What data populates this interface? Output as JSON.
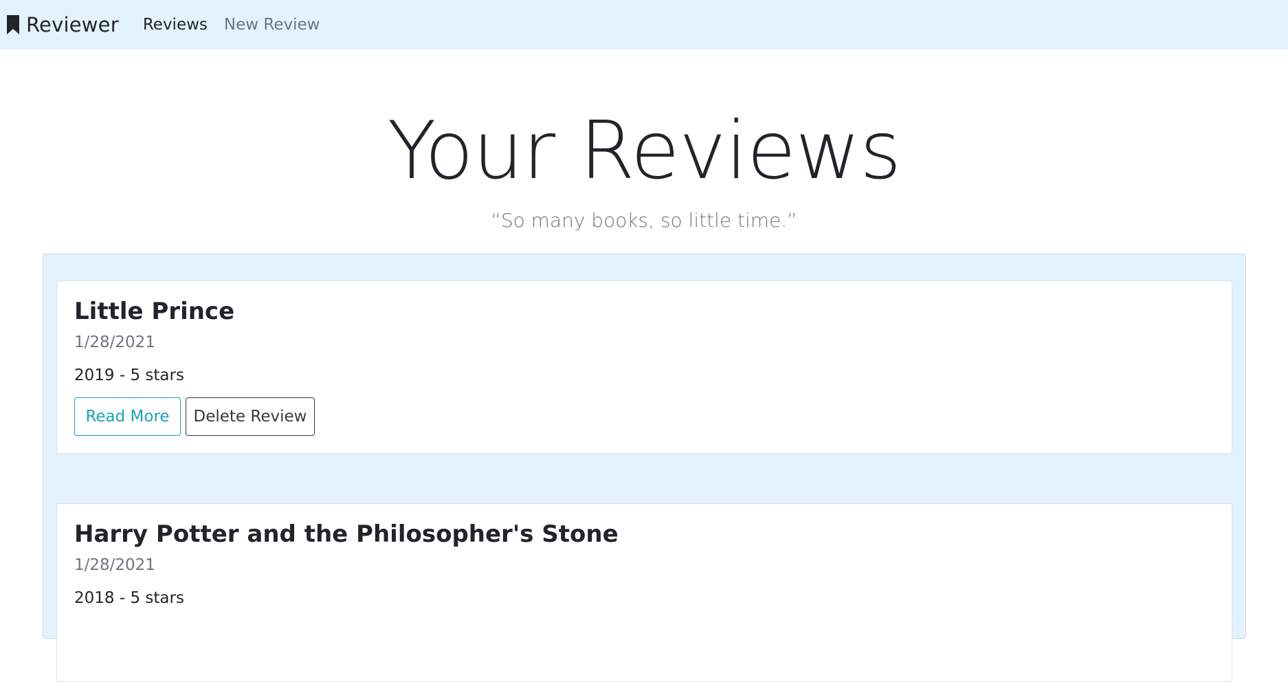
{
  "navbar": {
    "brand_icon": "bookmark-icon",
    "brand_label": "Reviewer",
    "links": [
      {
        "label": "Reviews",
        "active": true
      },
      {
        "label": "New Review",
        "active": false
      }
    ],
    "background": "#e3f2fd"
  },
  "hero": {
    "title": "Your Reviews",
    "subtitle": "“So many books, so little time.”"
  },
  "reviews": [
    {
      "title": "Little Prince",
      "date": "1/28/2021",
      "summary": "2019 - 5 stars",
      "read_more_label": "Read More",
      "delete_label": "Delete Review"
    },
    {
      "title": "Harry Potter and the Philosopher's Stone",
      "date": "1/28/2021",
      "summary": "2018 - 5 stars"
    }
  ],
  "colors": {
    "accent_info": "#17a2b8",
    "accent_dark": "#343a40",
    "panel": "#e3f2fd",
    "muted": "#6c757d"
  }
}
